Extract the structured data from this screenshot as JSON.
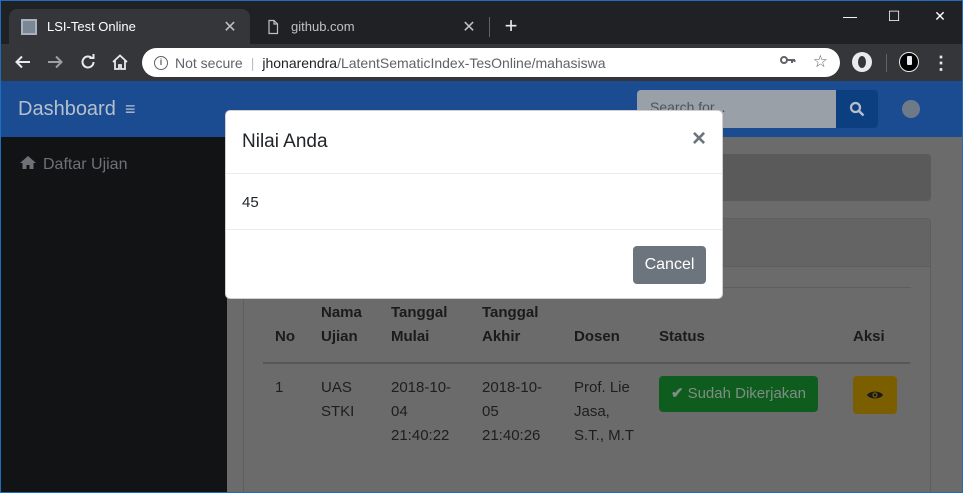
{
  "browser": {
    "tabs": [
      {
        "title": "LSI-Test Online",
        "active": true
      },
      {
        "title": "github.com",
        "active": false
      }
    ],
    "address": {
      "security_label": "Not secure",
      "host": "jhonarendra",
      "path": "/LatentSematicIndex-TesOnline/mahasiswa"
    },
    "icons": [
      "back-arrow-icon",
      "forward-arrow-icon",
      "reload-icon",
      "home-icon",
      "info-icon",
      "key-icon",
      "star-icon",
      "extension-icon",
      "profile-icon",
      "menu-dots-icon"
    ]
  },
  "app": {
    "brand": "Dashboard",
    "search_placeholder": "Search for...",
    "sidebar": {
      "items": [
        {
          "label": "Daftar Ujian",
          "icon": "home-icon"
        }
      ]
    }
  },
  "table": {
    "headers": [
      "No",
      "Nama Ujian",
      "Tanggal Mulai",
      "Tanggal Akhir",
      "Dosen",
      "Status",
      "Aksi"
    ],
    "rows": [
      {
        "no": "1",
        "nama_ujian": "UAS STKI",
        "tanggal_mulai": "2018-10-04 21:40:22",
        "tanggal_akhir": "2018-10-05 21:40:26",
        "dosen": "Prof. Lie Jasa, S.T., M.T",
        "status": "Sudah Dikerjakan",
        "aksi_icon": "eye-icon"
      }
    ]
  },
  "modal": {
    "title": "Nilai Anda",
    "value": "45",
    "cancel_label": "Cancel"
  },
  "colors": {
    "navbar": "#1b4b90",
    "sidebar": "#121314",
    "success": "#0f5c1f",
    "warning": "#7a5e00",
    "secondary_button": "#6c757d",
    "window_border": "#1f6dbf"
  }
}
